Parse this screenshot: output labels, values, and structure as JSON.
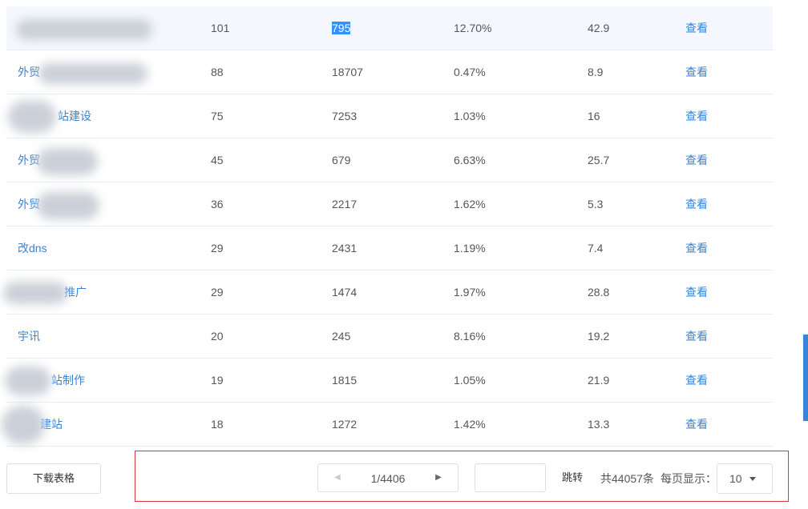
{
  "table": {
    "rows": [
      {
        "keyword": "",
        "v1": "101",
        "v2": "795",
        "v3": "12.70%",
        "v4": "42.9",
        "action": "查看"
      },
      {
        "keyword": "外贸",
        "v1": "88",
        "v2": "18707",
        "v3": "0.47%",
        "v4": "8.9",
        "action": "查看"
      },
      {
        "keyword": "站建设",
        "v1": "75",
        "v2": "7253",
        "v3": "1.03%",
        "v4": "16",
        "action": "查看"
      },
      {
        "keyword": "外贸",
        "v1": "45",
        "v2": "679",
        "v3": "6.63%",
        "v4": "25.7",
        "action": "查看"
      },
      {
        "keyword": "外贸",
        "v1": "36",
        "v2": "2217",
        "v3": "1.62%",
        "v4": "5.3",
        "action": "查看"
      },
      {
        "keyword": "改dns",
        "v1": "29",
        "v2": "2431",
        "v3": "1.19%",
        "v4": "7.4",
        "action": "查看"
      },
      {
        "keyword": "推广",
        "v1": "29",
        "v2": "1474",
        "v3": "1.97%",
        "v4": "28.8",
        "action": "查看"
      },
      {
        "keyword": "宇讯",
        "v1": "20",
        "v2": "245",
        "v3": "8.16%",
        "v4": "19.2",
        "action": "查看"
      },
      {
        "keyword": "站制作",
        "v1": "19",
        "v2": "1815",
        "v3": "1.05%",
        "v4": "21.9",
        "action": "查看"
      },
      {
        "keyword": "建站",
        "v1": "18",
        "v2": "1272",
        "v3": "1.42%",
        "v4": "13.3",
        "action": "查看"
      }
    ]
  },
  "footer": {
    "download_label": "下载表格",
    "page_indicator": "1/4406",
    "prev_icon": "◀",
    "next_icon": "▶",
    "jump_input_value": "",
    "jump_label": "跳转",
    "total_label": "共44057条",
    "per_page_label": "每页显示：",
    "per_page_value": "10"
  },
  "colors": {
    "link": "#3a84d6",
    "row_highlight": "#f4f8fe",
    "selection": "#3390ff",
    "outline_box": "#d9383a"
  }
}
